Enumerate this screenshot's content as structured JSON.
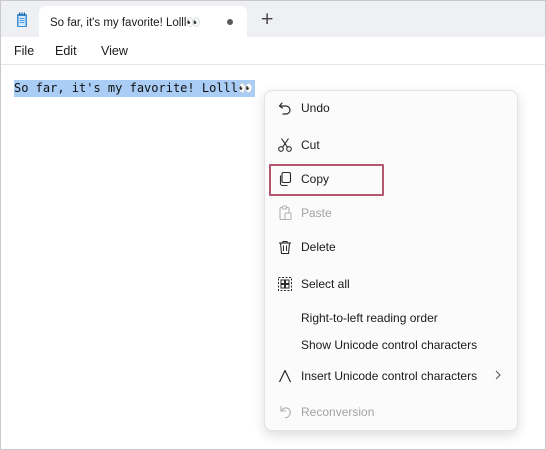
{
  "window": {
    "tab_title": "So far, it's my favorite! Lolll👀",
    "new_tab_symbol": "+"
  },
  "menubar": {
    "file": "File",
    "edit": "Edit",
    "view": "View"
  },
  "editor": {
    "text": "So far, it's my favorite! Lolll👀"
  },
  "context_menu": {
    "items": [
      {
        "label": "Undo",
        "icon": "undo-icon",
        "enabled": true
      },
      {
        "label": "Cut",
        "icon": "scissors-icon",
        "enabled": true
      },
      {
        "label": "Copy",
        "icon": "copy-icon",
        "enabled": true,
        "highlighted": true
      },
      {
        "label": "Paste",
        "icon": "paste-icon",
        "enabled": false
      },
      {
        "label": "Delete",
        "icon": "trash-icon",
        "enabled": true
      },
      {
        "label": "Select all",
        "icon": "select-all-icon",
        "enabled": true
      },
      {
        "label": "Right-to-left reading order",
        "enabled": true
      },
      {
        "label": "Show Unicode control characters",
        "enabled": true
      },
      {
        "label": "Insert Unicode control characters",
        "icon": "caret-icon",
        "enabled": true,
        "submenu": true
      },
      {
        "label": "Reconversion",
        "icon": "reconversion-icon",
        "enabled": false
      }
    ]
  },
  "colors": {
    "selection": "#a9cdf5",
    "highlight_box": "#b5566f",
    "titlebar": "#eef0f3"
  }
}
